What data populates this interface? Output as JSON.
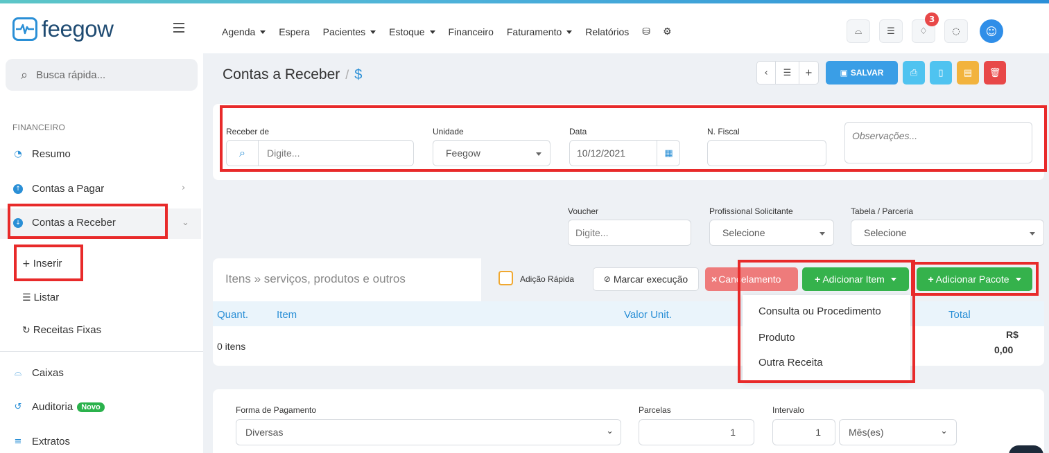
{
  "header": {
    "logo_text": "feegow",
    "nav": [
      {
        "label": "Agenda",
        "has_dropdown": true
      },
      {
        "label": "Espera",
        "has_dropdown": false
      },
      {
        "label": "Pacientes",
        "has_dropdown": true
      },
      {
        "label": "Estoque",
        "has_dropdown": true
      },
      {
        "label": "Financeiro",
        "has_dropdown": false
      },
      {
        "label": "Faturamento",
        "has_dropdown": true
      },
      {
        "label": "Relatórios",
        "has_dropdown": false
      }
    ],
    "nav_icons": [
      "database-icon",
      "settings-icon"
    ],
    "right_icons": [
      "inbox-icon",
      "checklist-icon",
      "bell-icon",
      "chat-icon"
    ],
    "notification_count": "3",
    "brand_color": "#2a8fd6"
  },
  "sidebar": {
    "search_placeholder": "Busca rápida...",
    "section_label": "FINANCEIRO",
    "items": [
      {
        "label": "Resumo",
        "icon": "chart-icon"
      },
      {
        "label": "Contas a Pagar",
        "icon": "arrow-up-circle-icon"
      },
      {
        "label": "Contas a Receber",
        "icon": "arrow-down-circle-icon"
      },
      {
        "label": "Caixas",
        "icon": "inbox-icon"
      },
      {
        "label": "Auditoria",
        "icon": "history-icon",
        "badge": "Novo"
      },
      {
        "label": "Extratos",
        "icon": "list-icon"
      }
    ],
    "subitems": [
      {
        "label": "Inserir",
        "icon": "plus-icon"
      },
      {
        "label": "Listar",
        "icon": "list-icon"
      },
      {
        "label": "Receitas Fixas",
        "icon": "refresh-icon"
      }
    ]
  },
  "page": {
    "title": "Contas a Receber",
    "separator": "/",
    "title_icon": "$",
    "save_label": "SALVAR",
    "colors": {
      "save": "#3a9ee6",
      "print": "#4fc3f0",
      "doc": "#4fc3f0",
      "file": "#f2b33d",
      "delete": "#e84848"
    }
  },
  "form": {
    "receber_de": {
      "label": "Receber de",
      "placeholder": "Digite..."
    },
    "unidade": {
      "label": "Unidade",
      "value": "Feegow"
    },
    "data": {
      "label": "Data",
      "value": "10/12/2021"
    },
    "n_fiscal": {
      "label": "N. Fiscal",
      "value": ""
    },
    "observacoes": {
      "placeholder": "Observações..."
    },
    "voucher": {
      "label": "Voucher",
      "placeholder": "Digite..."
    },
    "profissional": {
      "label": "Profissional Solicitante",
      "value": "Selecione"
    },
    "tabela": {
      "label": "Tabela / Parceria",
      "value": "Selecione"
    }
  },
  "items_section": {
    "title": "Itens » serviços, produtos e outros",
    "quick_add_label": "Adição Rápida",
    "mark_execution_label": "Marcar execução",
    "cancel_label": "Cancelamento",
    "add_item_label": "Adicionar Item",
    "add_package_label": "Adicionar Pacote",
    "columns": [
      "Quant.",
      "Item",
      "Valor Unit.",
      "Total"
    ],
    "count_label": "0 itens",
    "total_currency": "R$",
    "total_value": "0,00",
    "dropdown_options": [
      "Consulta ou Procedimento",
      "Produto",
      "Outra Receita"
    ]
  },
  "payment": {
    "forma_label": "Forma de Pagamento",
    "forma_value": "Diversas",
    "parcelas_label": "Parcelas",
    "parcelas_value": "1",
    "intervalo_label": "Intervalo",
    "intervalo_value": "1",
    "intervalo_unit": "Mês(es)"
  }
}
